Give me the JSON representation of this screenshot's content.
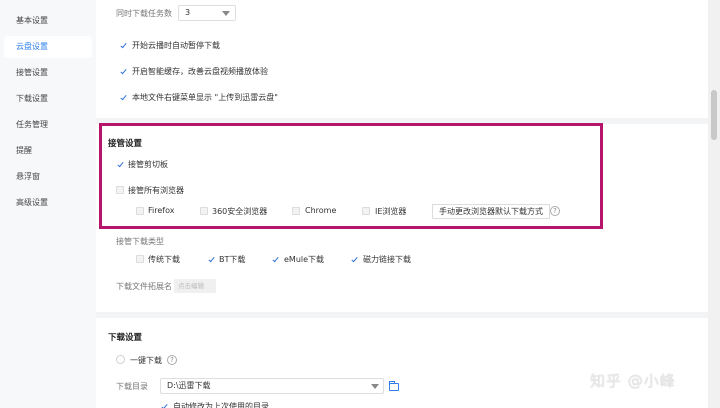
{
  "sidebar": {
    "items": [
      {
        "label": "基本设置"
      },
      {
        "label": "云盘设置"
      },
      {
        "label": "接管设置"
      },
      {
        "label": "下载设置"
      },
      {
        "label": "任务管理"
      },
      {
        "label": "提醒"
      },
      {
        "label": "悬浮窗"
      },
      {
        "label": "高级设置"
      }
    ],
    "active_index": 1
  },
  "cloud": {
    "concurrent_label": "同时下载任务数",
    "concurrent_value": "3",
    "opt1": "开始云播时自动暂停下载",
    "opt2": "开启智能缓存，改善云盘视频播放体验",
    "opt3": "本地文件右键菜单显示 \"上传到迅雷云盘\""
  },
  "takeover": {
    "heading": "接管设置",
    "clipboard": "接管剪切板",
    "all_browsers": "接管所有浏览器",
    "browsers": [
      "Firefox",
      "360安全浏览器",
      "Chrome",
      "IE浏览器"
    ],
    "change_default_button": "手动更改浏览器默认下载方式",
    "help": "?",
    "types_label": "接管下载类型",
    "types": [
      "传统下载",
      "BT下载",
      "eMule下载",
      "磁力链接下载"
    ],
    "ext_label": "下载文件拓展名",
    "ext_placeholder": "点击编辑"
  },
  "download": {
    "heading": "下载设置",
    "one_click": "一键下载",
    "help": "?",
    "dir_label": "下载目录",
    "dir_value": "D:\\迅雷下载",
    "partial_option": "自动修改为上次使用的目录"
  },
  "watermark": "知乎 @小峰"
}
